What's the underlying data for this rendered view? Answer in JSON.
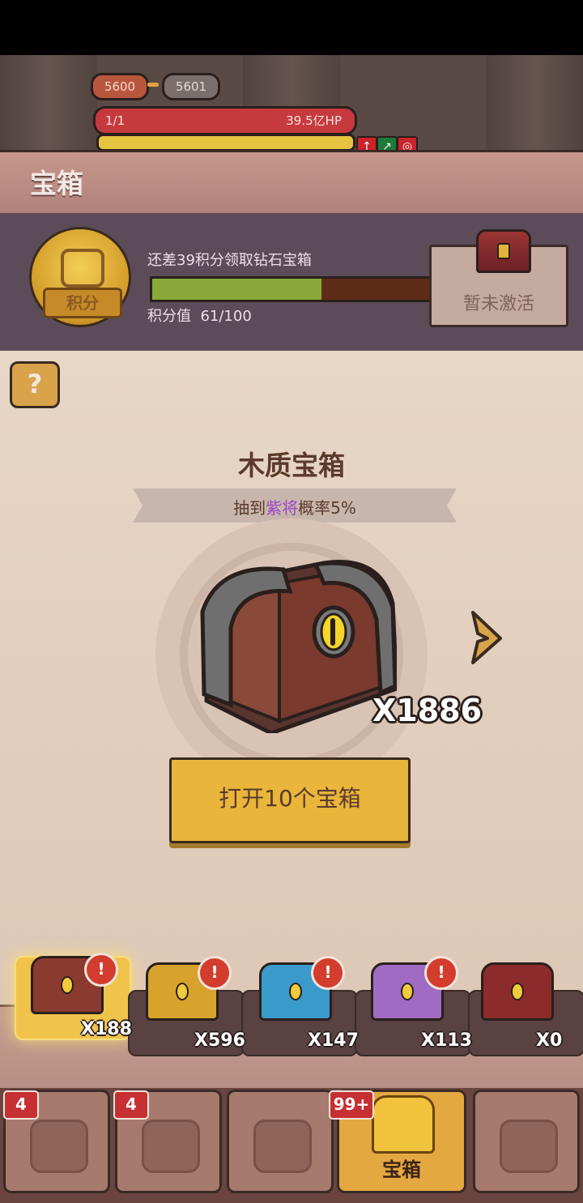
{
  "battle": {
    "level_current": "5600",
    "level_next": "5601",
    "hp_left": "1/1",
    "hp_right": "39.5亿HP"
  },
  "header": {
    "title": "宝箱"
  },
  "points": {
    "medal_label": "积分",
    "message": "还差39积分领取钻石宝箱",
    "progress_fraction": 0.61,
    "value_label": "积分值",
    "value": "61/100",
    "inactive_label": "暂未激活"
  },
  "main": {
    "help": "?",
    "chest_name": "木质宝箱",
    "rate_prefix": "抽到",
    "rate_highlight": "紫将",
    "rate_suffix": "概率5%",
    "count": "X1886",
    "open_button": "打开10个宝箱",
    "accent_purple": "#9a45c8"
  },
  "chests": [
    {
      "icon": "wood-chest",
      "qty": "X188",
      "color": "#8a3a2e"
    },
    {
      "icon": "gold-chest",
      "qty": "X596",
      "color": "#d7a32c"
    },
    {
      "icon": "blue-chest",
      "qty": "X147",
      "color": "#3a9bcb"
    },
    {
      "icon": "purple-chest",
      "qty": "X113",
      "color": "#9f6bc3"
    },
    {
      "icon": "diamond-chest",
      "qty": "X0",
      "color": "#8c2b2b"
    }
  ],
  "nav": {
    "badge1": "4",
    "badge2": "4",
    "badge_chest": "99+",
    "chest_label": "宝箱"
  }
}
